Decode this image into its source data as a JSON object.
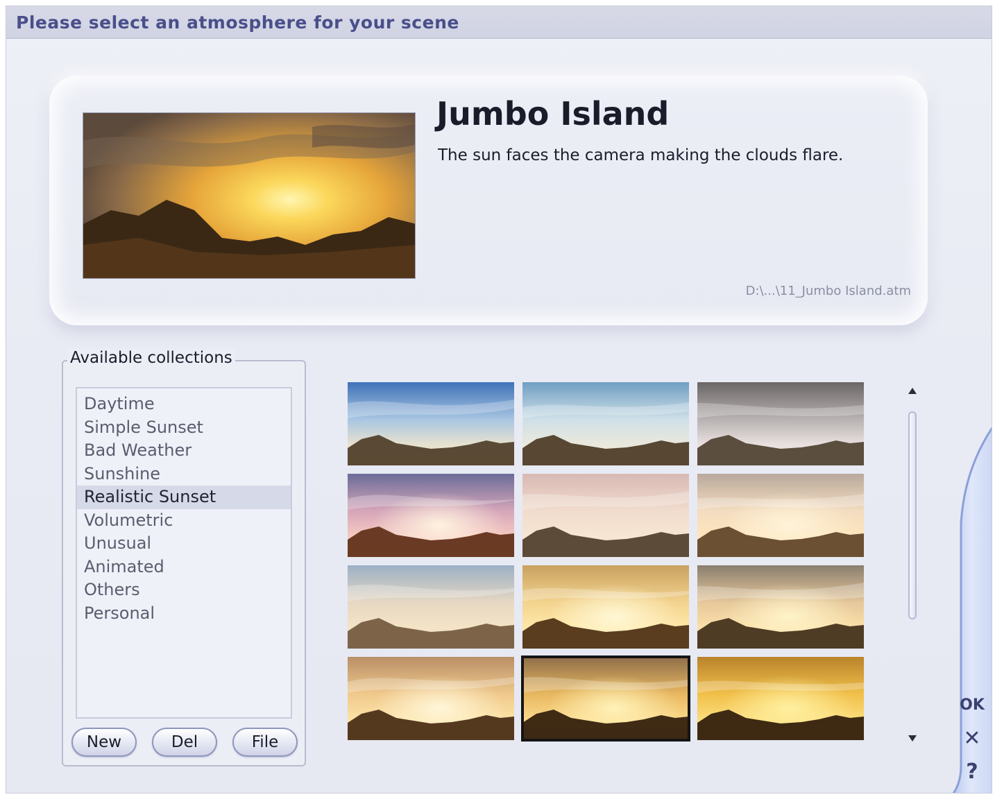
{
  "title": "Please select an atmosphere for your scene",
  "preview": {
    "name": "Jumbo Island",
    "description": "The sun faces the camera making the clouds flare.",
    "file_path": "D:\\...\\11_Jumbo Island.atm"
  },
  "collections": {
    "legend": "Available collections",
    "items": [
      {
        "label": "Daytime",
        "selected": false
      },
      {
        "label": "Simple Sunset",
        "selected": false
      },
      {
        "label": "Bad Weather",
        "selected": false
      },
      {
        "label": "Sunshine",
        "selected": false
      },
      {
        "label": "Realistic Sunset",
        "selected": true
      },
      {
        "label": "Volumetric",
        "selected": false
      },
      {
        "label": "Unusual",
        "selected": false
      },
      {
        "label": "Animated",
        "selected": false
      },
      {
        "label": "Others",
        "selected": false
      },
      {
        "label": "Personal",
        "selected": false
      }
    ],
    "buttons": {
      "new": "New",
      "del": "Del",
      "file": "File"
    }
  },
  "thumbnails": [
    {
      "sky_top": "#3f72b8",
      "sky_mid": "#a9c6e2",
      "horizon": "#e7e1cf",
      "sun": "",
      "ground": "#5a4a35",
      "selected": false
    },
    {
      "sky_top": "#6f9ec2",
      "sky_mid": "#cfe0e8",
      "horizon": "#eae8dc",
      "sun": "",
      "ground": "#574733",
      "selected": false
    },
    {
      "sky_top": "#6b6666",
      "sky_mid": "#b8b2b2",
      "horizon": "#e9e1df",
      "sun": "",
      "ground": "#5b4e3f",
      "selected": false
    },
    {
      "sky_top": "#6a6c98",
      "sky_mid": "#d6a6b9",
      "horizon": "#f5c9c2",
      "sun": "#fff2e0",
      "ground": "#6b3a24",
      "selected": false
    },
    {
      "sky_top": "#d8b9b4",
      "sky_mid": "#f1dccd",
      "horizon": "#f6e6d2",
      "sun": "",
      "ground": "#5c4b39",
      "selected": false
    },
    {
      "sky_top": "#b9a99c",
      "sky_mid": "#f3dcc0",
      "horizon": "#fde5bc",
      "sun": "#fff3d8",
      "ground": "#6b5033",
      "selected": false
    },
    {
      "sky_top": "#9bb0c4",
      "sky_mid": "#e7d8c3",
      "horizon": "#f4e3c6",
      "sun": "",
      "ground": "#7d6448",
      "selected": false
    },
    {
      "sky_top": "#c9a160",
      "sky_mid": "#f3d48f",
      "horizon": "#ffe7a8",
      "sun": "#fff7d4",
      "ground": "#5a3c1e",
      "selected": false
    },
    {
      "sky_top": "#8a7e6f",
      "sky_mid": "#e6c89b",
      "horizon": "#fbe0a8",
      "sun": "#fff3c9",
      "ground": "#4f3c24",
      "selected": false
    },
    {
      "sky_top": "#b98f66",
      "sky_mid": "#f0c98c",
      "horizon": "#fde2a6",
      "sun": "#fff6d8",
      "ground": "#55391f",
      "selected": false
    },
    {
      "sky_top": "#8f6e4a",
      "sky_mid": "#e8b860",
      "horizon": "#fbd88a",
      "sun": "#fff2b8",
      "ground": "#3f2a14",
      "selected": true
    },
    {
      "sky_top": "#b9832b",
      "sky_mid": "#f1c04a",
      "horizon": "#fbdc7c",
      "sun": "#fff0a0",
      "ground": "#3e2a12",
      "selected": false
    }
  ],
  "side_buttons": {
    "ok": "OK",
    "cancel": "✕",
    "help": "?"
  },
  "colors": {
    "accent": "#4a4f8a",
    "selection": "#d6d9e8"
  }
}
